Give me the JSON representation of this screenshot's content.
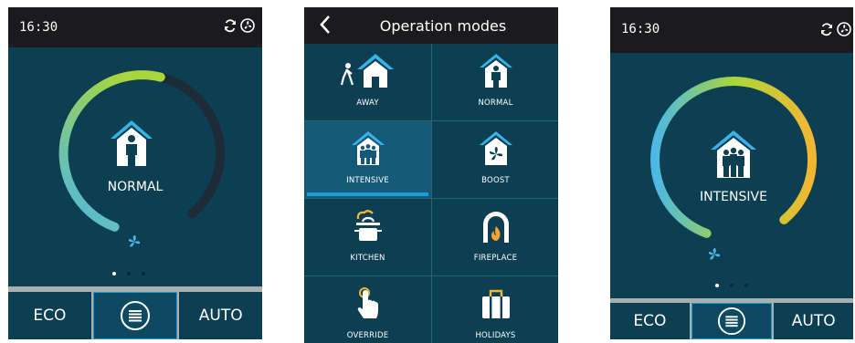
{
  "screens": [
    {
      "time": "16:30",
      "mode_label": "NORMAL",
      "gauge_level": 0.58,
      "page_dots": [
        true,
        false,
        false
      ],
      "buttons": {
        "left": "ECO",
        "right": "AUTO"
      }
    },
    {
      "title": "Operation modes",
      "modes": [
        {
          "label": "AWAY",
          "icon": "away-icon",
          "selected": false
        },
        {
          "label": "NORMAL",
          "icon": "house-person-icon",
          "selected": false
        },
        {
          "label": "INTENSIVE",
          "icon": "house-group-icon",
          "selected": true
        },
        {
          "label": "BOOST",
          "icon": "house-fan-icon",
          "selected": false
        },
        {
          "label": "KITCHEN",
          "icon": "cooking-pot-icon",
          "selected": false
        },
        {
          "label": "FIREPLACE",
          "icon": "fireplace-icon",
          "selected": false
        },
        {
          "label": "OVERRIDE",
          "icon": "hand-pointer-icon",
          "selected": false
        },
        {
          "label": "HOLIDAYS",
          "icon": "suitcase-icon",
          "selected": false
        }
      ]
    },
    {
      "time": "16:30",
      "mode_label": "INTENSIVE",
      "gauge_level": 1.0,
      "page_dots": [
        true,
        false,
        false
      ],
      "buttons": {
        "left": "ECO",
        "right": "AUTO"
      }
    }
  ],
  "colors": {
    "screen_bg": "#0d3f52",
    "gauge_start": "#4bb8e6",
    "gauge_mid": "#a9d63c",
    "gauge_end": "#f2b732",
    "accent_blue": "#1d9bd6"
  }
}
